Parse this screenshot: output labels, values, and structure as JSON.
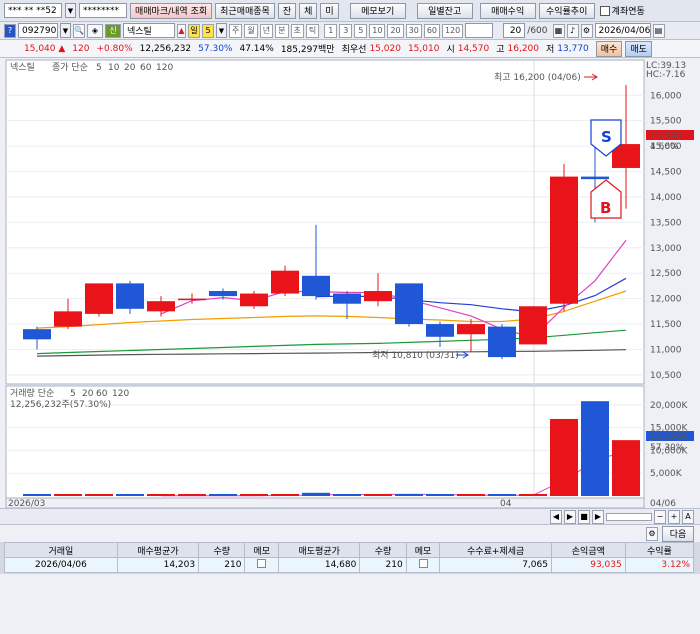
{
  "toolbar1": {
    "account_masked": "*** ** **52",
    "password_masked": "********",
    "tab_mark": "매매마크/내역 조회",
    "tab_recent": "최근매매종목",
    "tab_balance": "잔",
    "tab_trade": "체",
    "tab_unfilled": "미",
    "memo_btn": "메모보기",
    "daily_balance_btn": "일별잔고",
    "trade_profit_btn": "매매수익",
    "profit_trend_btn": "수익률추이",
    "account_link_label": "계좌연동"
  },
  "toolbar2": {
    "code": "092790",
    "credit_badge": "신",
    "stock_name": "넥스틸",
    "period_badge": "일",
    "period_value": "5",
    "periods": [
      "주",
      "월",
      "년",
      "분",
      "초",
      "틱"
    ],
    "minute_buttons": [
      "1",
      "3",
      "5",
      "10",
      "20",
      "30",
      "60",
      "120"
    ],
    "count": "20",
    "count_total": "/600",
    "date": "2026/04/06"
  },
  "quote": {
    "price": "15,040",
    "arrow": "▲",
    "change": "120",
    "change_rate": "+0.80%",
    "volume": "12,256,232",
    "ratio1": "57.30%",
    "ratio2": "47.14%",
    "amount": "185,297백만",
    "best_ask_label": "최우선",
    "ask": "15,020",
    "bid": "15,010",
    "open_label": "시",
    "open": "14,570",
    "high_label": "고",
    "high": "16,200",
    "low_label": "저",
    "low": "13,770",
    "buy_btn": "매수",
    "sell_btn": "매도"
  },
  "chart_panel": {
    "stock_label": "넥스틸",
    "ma_label": "종가 단순",
    "ma_periods": [
      "5",
      "10",
      "20",
      "60",
      "120"
    ],
    "vol_label": "거래량 단순",
    "vol_periods": [
      "5",
      "20",
      "60",
      "120"
    ],
    "vol_value_label": "12,256,232주(57.30%)",
    "high_annotation": "최고 16,200 (04/06)",
    "low_annotation": "최저 10,810 (03/31)",
    "lc_label": "LC:39.13",
    "hc_label": "HC:-7.16",
    "price_tag": "15,040",
    "price_tag_pct": "4.66%",
    "vol_tag": "12,256K",
    "vol_tag_pct": "57.30%",
    "sell_marker": "S",
    "buy_marker": "B",
    "x_left_label": "2026/03",
    "x_mid_label": "04",
    "x_right_label": "04/06",
    "colors": {
      "up": "#e8141a",
      "down": "#1f57d6",
      "ma5": "#e040c0",
      "ma10": "#1f3fd6",
      "ma20": "#f0a000",
      "ma60": "#1a9a3a",
      "ma120": "#555555"
    }
  },
  "chart_data": {
    "type": "candlestick",
    "price_axis": {
      "ticks": [
        "16,000",
        "15,500",
        "15,000",
        "14,500",
        "14,000",
        "13,500",
        "13,000",
        "12,500",
        "12,000",
        "11,500",
        "11,000",
        "10,500"
      ],
      "ylim": [
        10400,
        16300
      ]
    },
    "volume_axis": {
      "ticks": [
        "20,000K",
        "15,000K",
        "10,000K",
        "5,000K"
      ],
      "ylim": [
        0,
        21500
      ]
    },
    "candles": [
      {
        "open": 11400,
        "close": 11200,
        "high": 11450,
        "low": 11000
      },
      {
        "open": 11450,
        "close": 11750,
        "high": 12000,
        "low": 11400
      },
      {
        "open": 11700,
        "close": 12300,
        "high": 12300,
        "low": 11650
      },
      {
        "open": 12300,
        "close": 11800,
        "high": 12350,
        "low": 11700
      },
      {
        "open": 11750,
        "close": 11950,
        "high": 12050,
        "low": 11650
      },
      {
        "open": 12000,
        "close": 12000,
        "high": 12100,
        "low": 11900
      },
      {
        "open": 12150,
        "close": 12050,
        "high": 12200,
        "low": 11980
      },
      {
        "open": 11850,
        "close": 12100,
        "high": 12150,
        "low": 11800
      },
      {
        "open": 12100,
        "close": 12550,
        "high": 12650,
        "low": 12050
      },
      {
        "open": 12450,
        "close": 12050,
        "high": 13450,
        "low": 11980
      },
      {
        "open": 12100,
        "close": 11900,
        "high": 12150,
        "low": 11600
      },
      {
        "open": 11950,
        "close": 12150,
        "high": 12500,
        "low": 11850
      },
      {
        "open": 12300,
        "close": 11500,
        "high": 12300,
        "low": 11450
      },
      {
        "open": 11500,
        "close": 11250,
        "high": 11550,
        "low": 11050
      },
      {
        "open": 11300,
        "close": 11500,
        "high": 11600,
        "low": 10950
      },
      {
        "open": 11450,
        "close": 10850,
        "high": 11500,
        "low": 10810
      },
      {
        "open": 11100,
        "close": 11850,
        "high": 11850,
        "low": 11100
      },
      {
        "open": 11900,
        "close": 14400,
        "high": 14650,
        "low": 11750
      },
      {
        "open": 14400,
        "close": 14350,
        "high": 15400,
        "low": 13500
      },
      {
        "open": 14570,
        "close": 15040,
        "high": 16200,
        "low": 13770
      }
    ],
    "volumes": [
      50,
      90,
      70,
      40,
      60,
      40,
      90,
      30,
      380,
      700,
      300,
      260,
      330,
      60,
      90,
      170,
      80,
      16900,
      20800,
      12256
    ],
    "ma5": [
      null,
      null,
      null,
      null,
      11700,
      11960,
      12020,
      11960,
      12140,
      12140,
      12120,
      12120,
      11980,
      11820,
      11660,
      11400,
      11240,
      11830,
      12350,
      13150
    ],
    "ma10": [
      null,
      null,
      null,
      null,
      null,
      null,
      null,
      null,
      null,
      12040,
      12050,
      12040,
      11980,
      11920,
      11880,
      11800,
      11740,
      11860,
      12060,
      12400
    ],
    "ma20": [
      11420,
      11450,
      11490,
      11530,
      11560,
      11590,
      11610,
      11630,
      11650,
      11660,
      11650,
      11630,
      11600,
      11580,
      11550,
      11550,
      11600,
      11750,
      11950,
      12150
    ],
    "ma60": [
      10920,
      10940,
      10960,
      10980,
      11000,
      11020,
      11040,
      11060,
      11080,
      11100,
      11110,
      11120,
      11140,
      11160,
      11180,
      11200,
      11230,
      11280,
      11330,
      11380
    ],
    "ma120": [
      10870,
      10880,
      10890,
      10900,
      10905,
      10910,
      10915,
      10920,
      10925,
      10930,
      10935,
      10940,
      10945,
      10950,
      10955,
      10960,
      10965,
      10975,
      10985,
      10995
    ]
  },
  "bottom_controls": [
    "◀",
    "▶",
    "■",
    "▶",
    "−",
    "+",
    "A"
  ],
  "table": {
    "next_btn": "다음",
    "headers": [
      "거래일",
      "매수평균가",
      "수량",
      "메모",
      "매도평균가",
      "수량",
      "메모",
      "수수료+제세금",
      "손익금액",
      "수익률"
    ],
    "rows": [
      [
        "2026/04/06",
        "14,203",
        "210",
        "",
        "14,680",
        "210",
        "",
        "7,065",
        "93,035",
        "3.12%"
      ]
    ]
  }
}
